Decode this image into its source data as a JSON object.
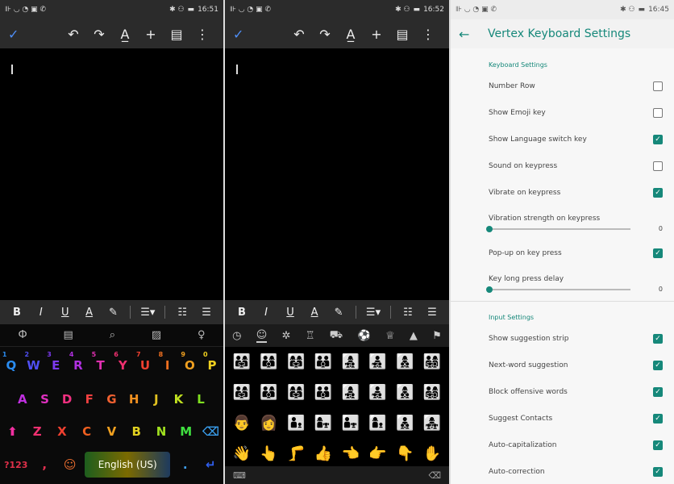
{
  "panel1": {
    "status": {
      "icons": "⊪ ◡ ◔ ▣ ✆",
      "right_icons": "✱ ⚇",
      "battery": "▬",
      "time": "16:51"
    },
    "toolbar": {
      "check": "✓",
      "undo": "↶",
      "redo": "↷",
      "text_format": "A̲",
      "add": "+",
      "comment": "▤",
      "more": "⋮"
    },
    "format": {
      "bold": "B",
      "italic": "I",
      "underline": "U",
      "text_color": "A",
      "highlight": "✎",
      "align": "☰▾",
      "bullets": "☷",
      "numbered": "☰"
    },
    "kbtools": [
      "Ф",
      "▤",
      "⌕",
      "▨",
      "♀"
    ],
    "row1": [
      {
        "k": "Q",
        "n": "1"
      },
      {
        "k": "W",
        "n": "2"
      },
      {
        "k": "E",
        "n": "3"
      },
      {
        "k": "R",
        "n": "4"
      },
      {
        "k": "T",
        "n": "5"
      },
      {
        "k": "Y",
        "n": "6"
      },
      {
        "k": "U",
        "n": "7"
      },
      {
        "k": "I",
        "n": "8"
      },
      {
        "k": "O",
        "n": "9"
      },
      {
        "k": "P",
        "n": "0"
      }
    ],
    "row2": [
      "A",
      "S",
      "D",
      "F",
      "G",
      "H",
      "J",
      "K",
      "L"
    ],
    "row3": [
      "Z",
      "X",
      "C",
      "V",
      "B",
      "N",
      "M"
    ],
    "shift": "⬆",
    "backspace": "⌫",
    "symbols": "?123",
    "comma": ",",
    "emoji": "☺",
    "space_label": "English (US)",
    "period": ".",
    "enter": "↵",
    "colors": {
      "q": "#2a8cf0",
      "w": "#5050f5",
      "e": "#7d3af0",
      "r": "#b030e0",
      "t": "#e030b0",
      "y": "#f03070",
      "u": "#f04030",
      "i": "#f07020",
      "o": "#f0a020",
      "p": "#f0d020",
      "a": "#c030e0",
      "s": "#e030c0",
      "d": "#f03080",
      "f": "#f04040",
      "g": "#f06030",
      "h": "#f09020",
      "j": "#e0c020",
      "k": "#c0e020",
      "l": "#80e020",
      "z": "#f03070",
      "x": "#f04030",
      "c": "#f06020",
      "v": "#f0a020",
      "b": "#e0d020",
      "n": "#a0e020",
      "m": "#40e040"
    }
  },
  "panel2": {
    "status": {
      "icons": "⊪ ◡ ◔ ▣ ✆",
      "right_icons": "✱ ⚇",
      "battery": "▬",
      "time": "16:52"
    },
    "categories": [
      "◷",
      "☺",
      "✲",
      "♖",
      "⛟",
      "⚽",
      "♕",
      "▲",
      "⚑"
    ],
    "emojis": [
      "👨‍👩‍👧",
      "👨‍👩‍👦",
      "👩‍👩‍👧",
      "👨‍👨‍👦",
      "👩‍👧‍👦",
      "👨‍👧‍👦",
      "👩‍👦‍👦",
      "👨‍👩‍👧‍👦",
      "👨‍👩‍👧",
      "👨‍👩‍👦",
      "👩‍👩‍👧",
      "👨‍👨‍👦",
      "👩‍👧‍👦",
      "👨‍👧‍👦",
      "👩‍👦‍👦",
      "👨‍👩‍👧‍👦",
      "👨",
      "👩",
      "👨‍👦",
      "👩‍👧",
      "👨‍👧",
      "👩‍👦",
      "👨‍👦‍👦",
      "👩‍👧‍👧",
      "👋",
      "👆",
      "🦵",
      "👍",
      "👈",
      "👉",
      "👇",
      "✋"
    ],
    "bottom_left": "⌨",
    "bottom_right": "⌫"
  },
  "panel3": {
    "status": {
      "icons": "⊪ ◡ ◔ ▣ ✆",
      "right_icons": "✱ ⚇",
      "battery": "▬",
      "time": "16:45"
    },
    "back": "←",
    "title": "Vertex Keyboard Settings",
    "section1": "Keyboard Settings",
    "number_row": "Number Row",
    "show_emoji_key": "Show Emoji key",
    "show_lang_switch": "Show Language switch key",
    "sound_on_keypress": "Sound on keypress",
    "vibrate_on_keypress": "Vibrate on keypress",
    "vibration_strength_label": "Vibration strength on keypress",
    "vibration_strength_value": "0",
    "popup_on_key_press": "Pop-up on key press",
    "long_press_label": "Key long press delay",
    "long_press_value": "0",
    "section2": "Input Settings",
    "show_suggestion_strip": "Show suggestion strip",
    "next_word_suggestion": "Next-word suggestion",
    "block_offensive_words": "Block offensive words",
    "suggest_contacts": "Suggest Contacts",
    "auto_capitalization": "Auto-capitalization",
    "auto_correction": "Auto-correction",
    "checkmark": "✓",
    "accent": "#16887a"
  }
}
